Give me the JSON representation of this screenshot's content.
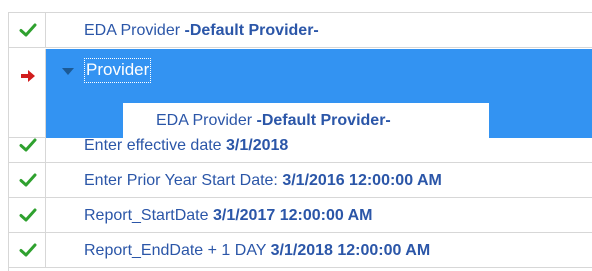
{
  "rows": [
    {
      "status": "check",
      "label": "EDA Provider",
      "value": "-Default Provider-"
    },
    {
      "status": "arrow",
      "label": "Provider",
      "expanded": true,
      "child": {
        "label": "EDA Provider",
        "value": "-Default Provider-"
      }
    },
    {
      "status": "check",
      "label": "Enter effective date",
      "value": "3/1/2018"
    },
    {
      "status": "check",
      "label": "Enter Prior Year Start Date:",
      "value": "3/1/2016 12:00:00 AM"
    },
    {
      "status": "check",
      "label": "Report_StartDate",
      "value": "3/1/2017 12:00:00 AM"
    },
    {
      "status": "check",
      "label": "Report_EndDate + 1 DAY",
      "value": "3/1/2018 12:00:00 AM"
    }
  ],
  "colors": {
    "check": "#2fa12f",
    "arrow": "#d11d1d",
    "selection": "#3393f2",
    "text": "#2b56a8"
  },
  "icons": {
    "check": "checkmark-icon",
    "arrow": "red-arrow-icon",
    "collapse": "collapse-triangle-icon"
  }
}
